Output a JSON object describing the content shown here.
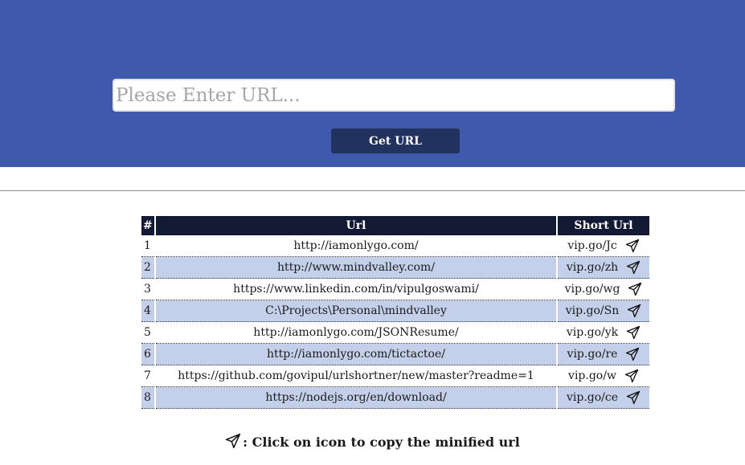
{
  "search": {
    "placeholder": "Please Enter URL...",
    "value": ""
  },
  "actions": {
    "get_url_label": "Get URL"
  },
  "table": {
    "headers": {
      "num": "#",
      "url": "Url",
      "short": "Short Url"
    },
    "rows": [
      {
        "num": "1",
        "url": "http://iamonlygo.com/",
        "short": "vip.go/Jc"
      },
      {
        "num": "2",
        "url": "http://www.mindvalley.com/",
        "short": "vip.go/zh"
      },
      {
        "num": "3",
        "url": "https://www.linkedin.com/in/vipulgoswami/",
        "short": "vip.go/wg"
      },
      {
        "num": "4",
        "url": "C:\\Projects\\Personal\\mindvalley",
        "short": "vip.go/Sn"
      },
      {
        "num": "5",
        "url": "http://iamonlygo.com/JSONResume/",
        "short": "vip.go/yk"
      },
      {
        "num": "6",
        "url": "http://iamonlygo.com/tictactoe/",
        "short": "vip.go/re"
      },
      {
        "num": "7",
        "url": "https://github.com/govipul/urlshortner/new/master?readme=1",
        "short": "vip.go/w"
      },
      {
        "num": "8",
        "url": "https://nodejs.org/en/download/",
        "short": "vip.go/ce"
      }
    ],
    "copy_icon": "paper-plane-icon"
  },
  "footnote": {
    "text": ": Click on icon to copy the minified url",
    "icon": "paper-plane-icon"
  },
  "colors": {
    "hero_bg": "#3f5aad",
    "button_bg": "#22325f",
    "header_bg": "#131a33",
    "alt_row_bg": "#c4d0ea"
  }
}
